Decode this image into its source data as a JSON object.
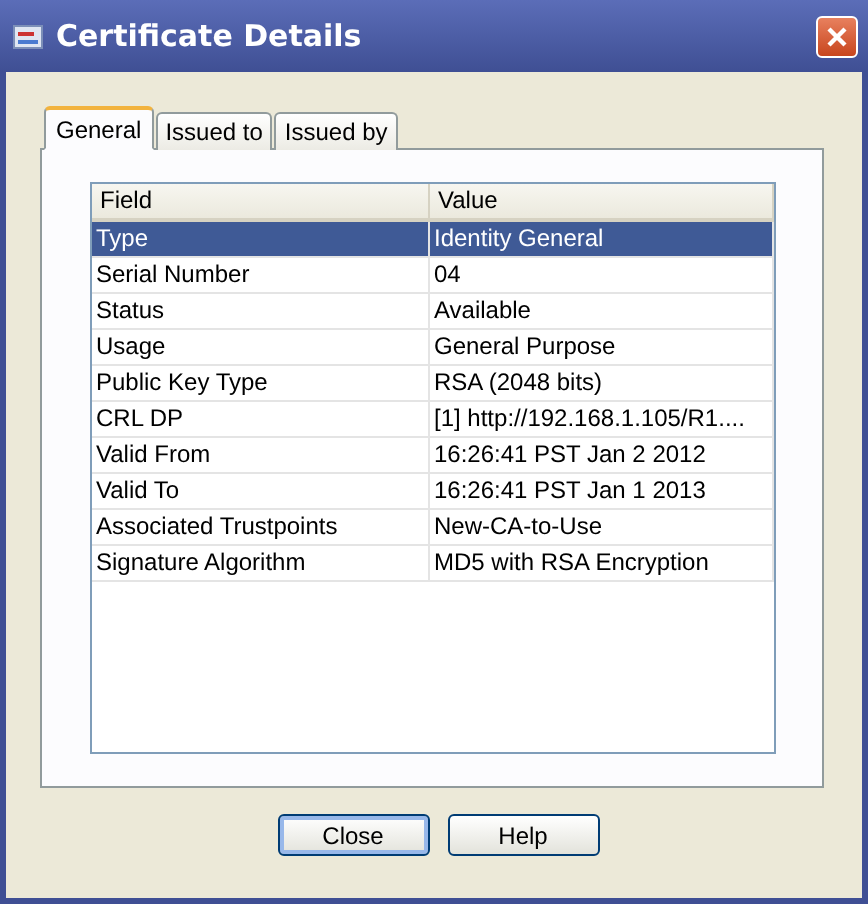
{
  "window": {
    "title": "Certificate Details"
  },
  "tabs": [
    {
      "label": "General",
      "selected": true
    },
    {
      "label": "Issued to",
      "selected": false
    },
    {
      "label": "Issued by",
      "selected": false
    }
  ],
  "table": {
    "columns": [
      "Field",
      "Value"
    ],
    "rows": [
      {
        "cells": [
          "Type",
          "Identity General"
        ],
        "selected": true
      },
      {
        "cells": [
          "Serial Number",
          "04"
        ],
        "selected": false
      },
      {
        "cells": [
          "Status",
          "Available"
        ],
        "selected": false
      },
      {
        "cells": [
          "Usage",
          "General Purpose"
        ],
        "selected": false
      },
      {
        "cells": [
          "Public Key Type",
          "RSA (2048 bits)"
        ],
        "selected": false
      },
      {
        "cells": [
          "CRL DP",
          "[1]  http://192.168.1.105/R1...."
        ],
        "selected": false
      },
      {
        "cells": [
          "Valid From",
          "16:26:41 PST Jan 2 2012"
        ],
        "selected": false
      },
      {
        "cells": [
          "Valid To",
          "16:26:41 PST Jan 1 2013"
        ],
        "selected": false
      },
      {
        "cells": [
          "Associated Trustpoints",
          "New-CA-to-Use"
        ],
        "selected": false
      },
      {
        "cells": [
          "Signature Algorithm",
          "MD5 with RSA Encryption"
        ],
        "selected": false
      }
    ]
  },
  "buttons": [
    {
      "label": "Close",
      "default": true
    },
    {
      "label": "Help",
      "default": false
    }
  ]
}
